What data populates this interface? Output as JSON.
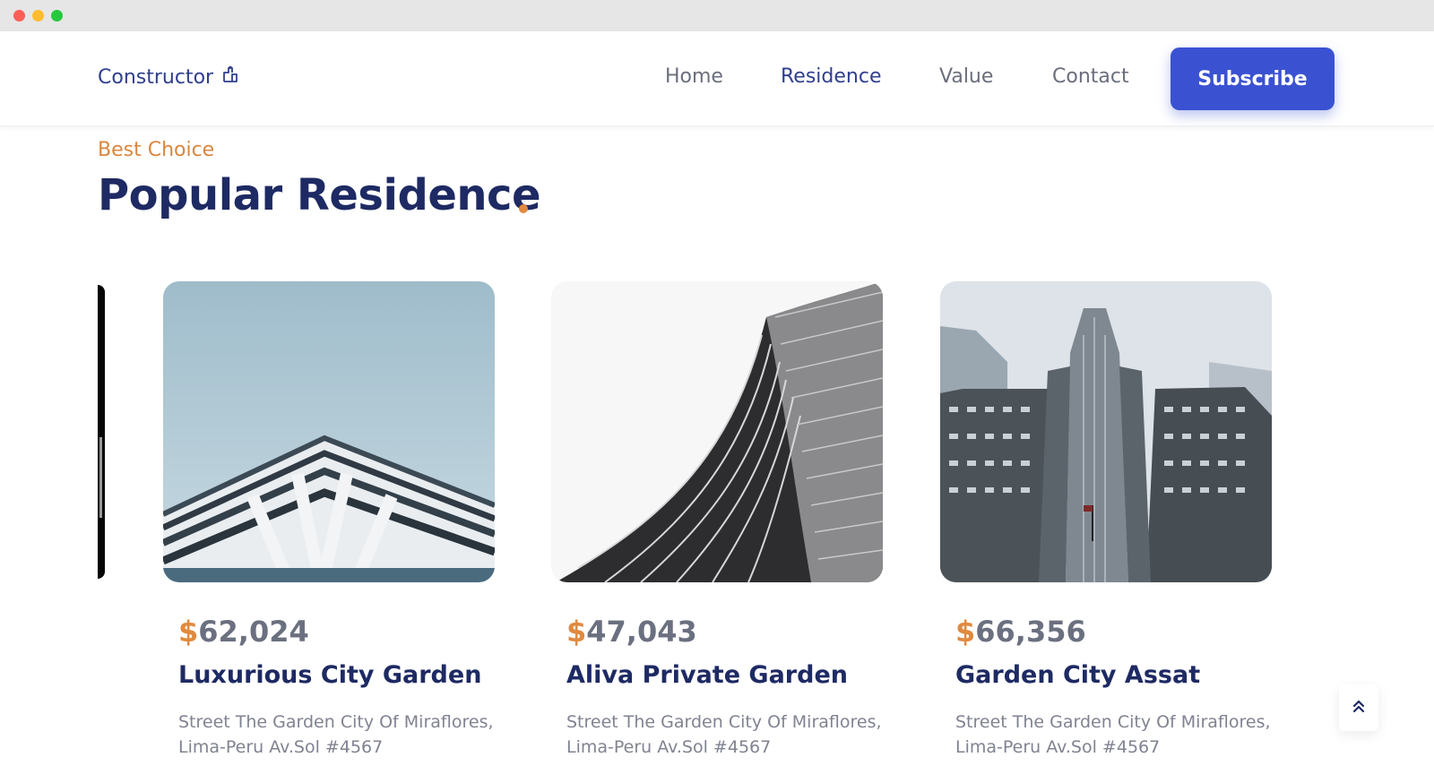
{
  "header": {
    "logo_text": "Constructor",
    "logo_icon": "building-icon",
    "nav": [
      {
        "label": "Home",
        "active": false
      },
      {
        "label": "Residence",
        "active": true
      },
      {
        "label": "Value",
        "active": false
      },
      {
        "label": "Contact",
        "active": false
      }
    ],
    "subscribe_label": "Subscribe"
  },
  "section": {
    "eyebrow": "Best Choice",
    "title": "Popular Residence"
  },
  "cards": [
    {
      "currency": "$",
      "price": "62,024",
      "title": "Luxurious City Garden",
      "address_line1": "Street The Garden City Of Miraflores,",
      "address_line2": "Lima-Peru Av.Sol #4567"
    },
    {
      "currency": "$",
      "price": "47,043",
      "title": "Aliva Private Garden",
      "address_line1": "Street The Garden City Of Miraflores,",
      "address_line2": "Lima-Peru Av.Sol #4567"
    },
    {
      "currency": "$",
      "price": "66,356",
      "title": "Garden City Assat",
      "address_line1": "Street The Garden City Of Miraflores,",
      "address_line2": "Lima-Peru Av.Sol #4567"
    }
  ],
  "scroll_top_icon": "double-chevron-up-icon",
  "colors": {
    "accent": "#3a52d2",
    "navy": "#1e2a63",
    "orange": "#e08a3f",
    "muted": "#808391"
  }
}
